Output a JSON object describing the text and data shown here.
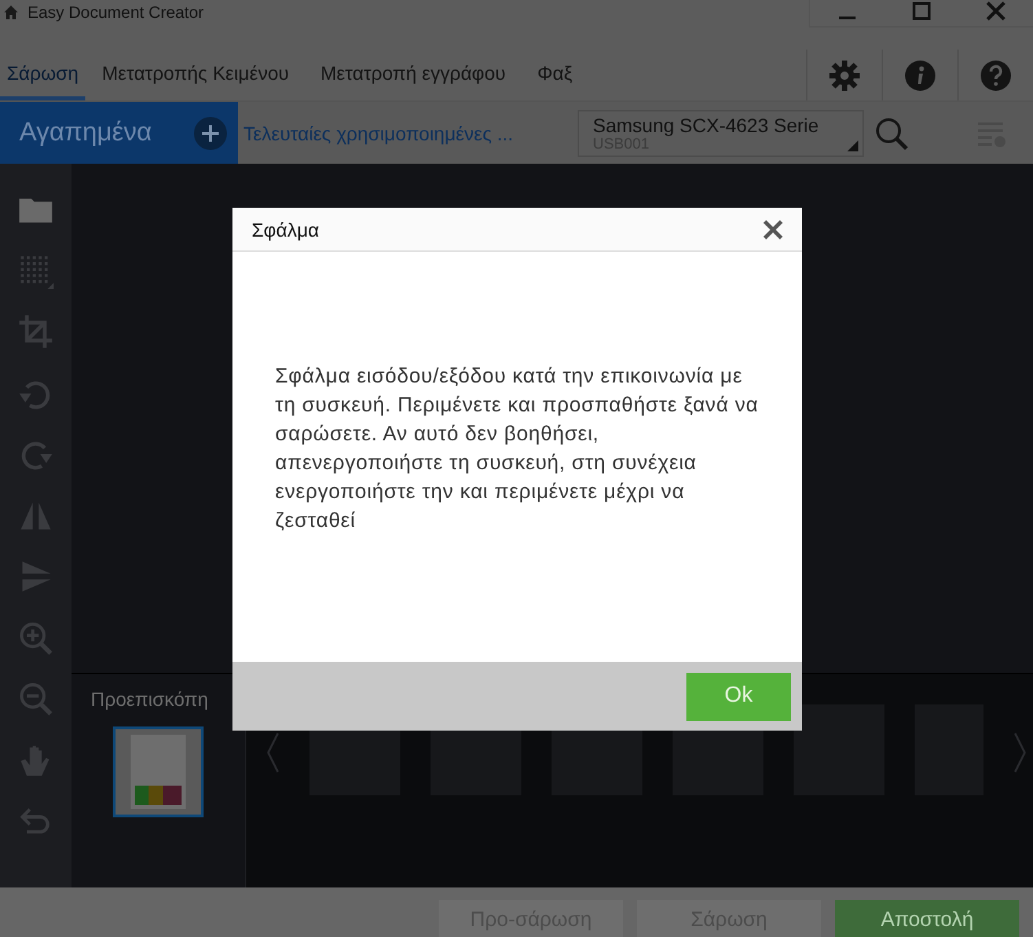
{
  "window": {
    "title": "Easy Document Creator"
  },
  "tabs": [
    {
      "label": "Σάρωση",
      "selected": true
    },
    {
      "label": "Μετατροπής Κειμένου",
      "selected": false
    },
    {
      "label": "Μετατροπή εγγράφου",
      "selected": false
    },
    {
      "label": "Φαξ",
      "selected": false
    }
  ],
  "favorites": {
    "label": "Αγαπημένα",
    "recent": "Τελευταίες χρησιμοποιημένες ..."
  },
  "device": {
    "name": "Samsung SCX-4623 Serie",
    "port": "USB001"
  },
  "preview": {
    "label": "Προεπισκόπη",
    "thumbnails": [
      {
        "selected": true
      }
    ]
  },
  "actions": [
    {
      "label": "Προ-σάρωση",
      "kind": "secondary"
    },
    {
      "label": "Σάρωση",
      "kind": "secondary"
    },
    {
      "label": "Αποστολή",
      "kind": "primary"
    }
  ],
  "dialog": {
    "title": "Σφάλμα",
    "message": "Σφάλμα εισόδου/εξόδου κατά την  επικοινωνία με τη συσκευή. Περιμένετε και προσπαθήστε ξανά να σαρώσετε. Αν αυτό δεν βοηθήσει, απενεργοποιήστε τη συσκευή, στη συνέχεια ενεργοποιήστε την και περιμένετε μέχρι να ζεσταθεί",
    "button": "Ok"
  }
}
